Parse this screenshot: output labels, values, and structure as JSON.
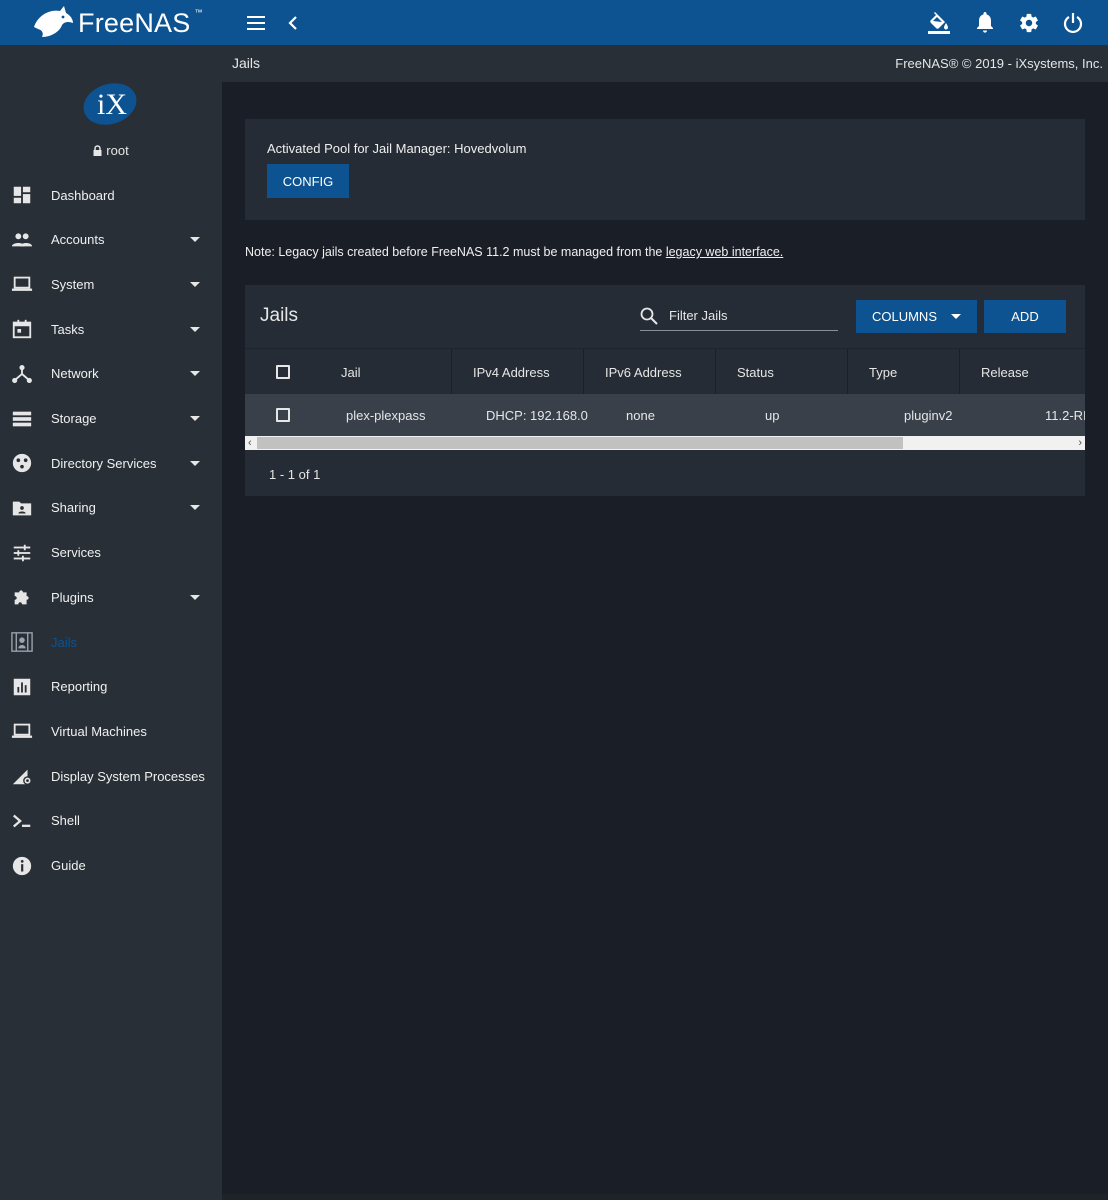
{
  "header": {
    "logo_text": "FreeNAS",
    "logo_tm": "™",
    "icons": [
      "menu-icon",
      "chevron-left-icon",
      "paint-bucket-icon",
      "bell-icon",
      "gear-icon",
      "power-icon"
    ]
  },
  "sidebar": {
    "user": "root",
    "items": [
      {
        "label": "Dashboard",
        "icon": "dashboard-icon",
        "caret": false
      },
      {
        "label": "Accounts",
        "icon": "accounts-icon",
        "caret": true
      },
      {
        "label": "System",
        "icon": "laptop-icon",
        "caret": true
      },
      {
        "label": "Tasks",
        "icon": "calendar-icon",
        "caret": true
      },
      {
        "label": "Network",
        "icon": "network-icon",
        "caret": true
      },
      {
        "label": "Storage",
        "icon": "storage-icon",
        "caret": true
      },
      {
        "label": "Directory Services",
        "icon": "directory-icon",
        "caret": true
      },
      {
        "label": "Sharing",
        "icon": "folder-share-icon",
        "caret": true
      },
      {
        "label": "Services",
        "icon": "sliders-icon",
        "caret": false
      },
      {
        "label": "Plugins",
        "icon": "puzzle-icon",
        "caret": true
      },
      {
        "label": "Jails",
        "icon": "jail-icon",
        "caret": false,
        "active": true
      },
      {
        "label": "Reporting",
        "icon": "chart-icon",
        "caret": false
      },
      {
        "label": "Virtual Machines",
        "icon": "laptop-icon",
        "caret": false
      },
      {
        "label": "Display System Processes",
        "icon": "processes-icon",
        "caret": false
      },
      {
        "label": "Shell",
        "icon": "shell-icon",
        "caret": false
      },
      {
        "label": "Guide",
        "icon": "info-icon",
        "caret": false
      }
    ]
  },
  "subbar": {
    "breadcrumb": "Jails",
    "copyright": "FreeNAS® © 2019 - iXsystems, Inc."
  },
  "config_card": {
    "pool_text": "Activated Pool for Jail Manager: Hovedvolum",
    "config_label": "CONFIG"
  },
  "note": {
    "prefix": "Note: Legacy jails created before FreeNAS 11.2 must be managed from the ",
    "link": "legacy web interface."
  },
  "table": {
    "title": "Jails",
    "filter_placeholder": "Filter Jails",
    "columns_label": "COLUMNS",
    "add_label": "ADD",
    "headers": [
      "Jail",
      "IPv4 Address",
      "IPv6 Address",
      "Status",
      "Type",
      "Release"
    ],
    "rows": [
      [
        "plex-plexpass",
        "DHCP: 192.168.0",
        "none",
        "up",
        "pluginv2",
        "11.2-RI"
      ]
    ],
    "pager": "1 - 1 of 1"
  },
  "colors": {
    "brand": "#0d5391",
    "sidebar": "#282f37",
    "content": "#1a1f27",
    "card": "#252c35"
  }
}
